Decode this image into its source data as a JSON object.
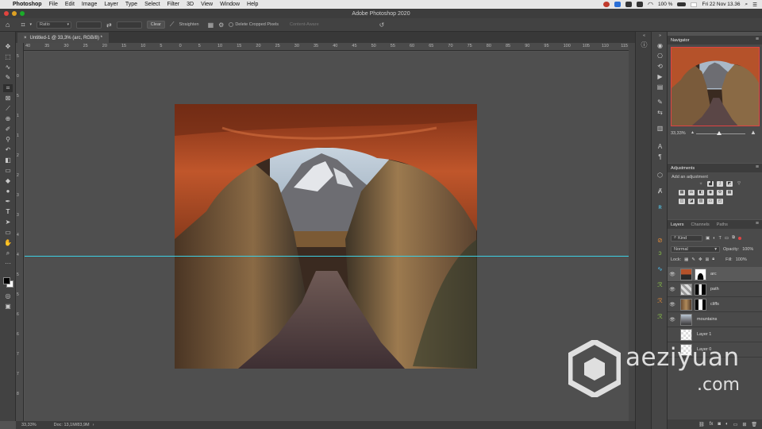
{
  "menubar": {
    "app_name": "Photoshop",
    "items": [
      "File",
      "Edit",
      "Image",
      "Layer",
      "Type",
      "Select",
      "Filter",
      "3D",
      "View",
      "Window",
      "Help"
    ],
    "battery": "100 %",
    "clock": "Fri 22 Nov  13.36"
  },
  "window": {
    "title": "Adobe Photoshop 2020"
  },
  "options_bar": {
    "ratio_label": "Ratio",
    "clear_label": "Clear",
    "straighten_label": "Straighten",
    "delete_cropped_label": "Delete Cropped Pixels",
    "content_aware_label": "Content-Aware"
  },
  "document": {
    "tab_title": "Untitled-1 @ 33,3% (arc, RGB/8) *",
    "ruler_h": [
      "40",
      "35",
      "30",
      "25",
      "20",
      "15",
      "10",
      "5",
      "0",
      "5",
      "10",
      "15",
      "20",
      "25",
      "30",
      "35",
      "40",
      "45",
      "50",
      "55",
      "60",
      "65",
      "70",
      "75",
      "80",
      "85",
      "90",
      "95",
      "100",
      "105",
      "110",
      "115"
    ],
    "ruler_v": [
      "5",
      "0",
      "5",
      "1",
      "1",
      "2",
      "2",
      "3",
      "3",
      "4",
      "4",
      "5",
      "5",
      "6",
      "6",
      "7",
      "7",
      "8"
    ]
  },
  "status_bar": {
    "zoom": "33,33%",
    "doc": "Doc: 13,1M/83,9M"
  },
  "navigator": {
    "title": "Navigator",
    "zoom": "33,33%"
  },
  "adjustments": {
    "title": "Adjustments",
    "subtitle": "Add an adjustment"
  },
  "layers_panel": {
    "tabs": [
      "Layers",
      "Channels",
      "Paths"
    ],
    "kind_label": "Kind",
    "blend_mode": "Normal",
    "opacity_label": "Opacity:",
    "opacity_value": "100%",
    "lock_label": "Lock:",
    "fill_label": "Fill:",
    "fill_value": "100%",
    "layers": [
      {
        "name": "arc",
        "selected": true
      },
      {
        "name": "path",
        "selected": false
      },
      {
        "name": "cliffs",
        "selected": false
      },
      {
        "name": "mountains",
        "selected": false
      },
      {
        "name": "Layer 1",
        "selected": false
      },
      {
        "name": "Layer 0",
        "selected": false
      }
    ]
  },
  "watermark": {
    "brand": "aeziyuan",
    "domain": ".com"
  },
  "colors": {
    "guide": "#3dd0e4",
    "nav_frame": "#e04343",
    "arc": "#b5522a"
  }
}
